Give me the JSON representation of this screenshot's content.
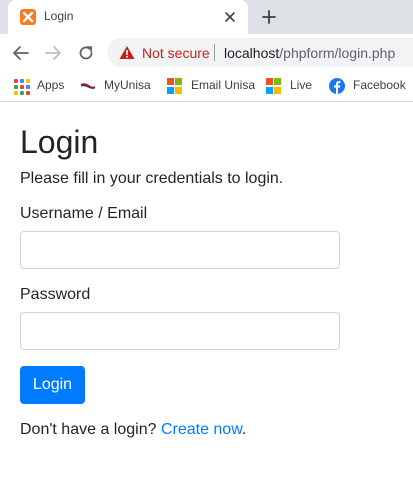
{
  "browser": {
    "tab": {
      "title": "Login",
      "favicon": "xampp-icon"
    },
    "new_tab_icon": "plus-icon",
    "toolbar": {
      "back_icon": "arrow-left-icon",
      "forward_icon": "arrow-right-icon",
      "reload_icon": "reload-icon",
      "security_icon": "warning-triangle-icon",
      "security_label": "Not secure",
      "url_host": "localhost",
      "url_path": "/phpform/login.php"
    },
    "bookmarks": [
      {
        "label": "Apps",
        "icon": "apps-grid-icon"
      },
      {
        "label": "MyUnisa",
        "icon": "unisa-flag-icon"
      },
      {
        "label": "Email Unisa",
        "icon": "microsoft-logo-icon"
      },
      {
        "label": "Live",
        "icon": "microsoft-logo-icon"
      },
      {
        "label": "Facebook",
        "icon": "facebook-icon"
      }
    ]
  },
  "page": {
    "title": "Login",
    "subtitle": "Please fill in your credentials to login.",
    "username_label": "Username / Email",
    "username_value": "",
    "password_label": "Password",
    "password_value": "",
    "login_button": "Login",
    "signup_prompt": "Don't have a login? ",
    "signup_link": "Create now",
    "signup_suffix": "."
  },
  "colors": {
    "primary": "#007bff",
    "text": "#212529",
    "not_secure": "#c5221f",
    "tabstrip": "#dee1e6"
  }
}
